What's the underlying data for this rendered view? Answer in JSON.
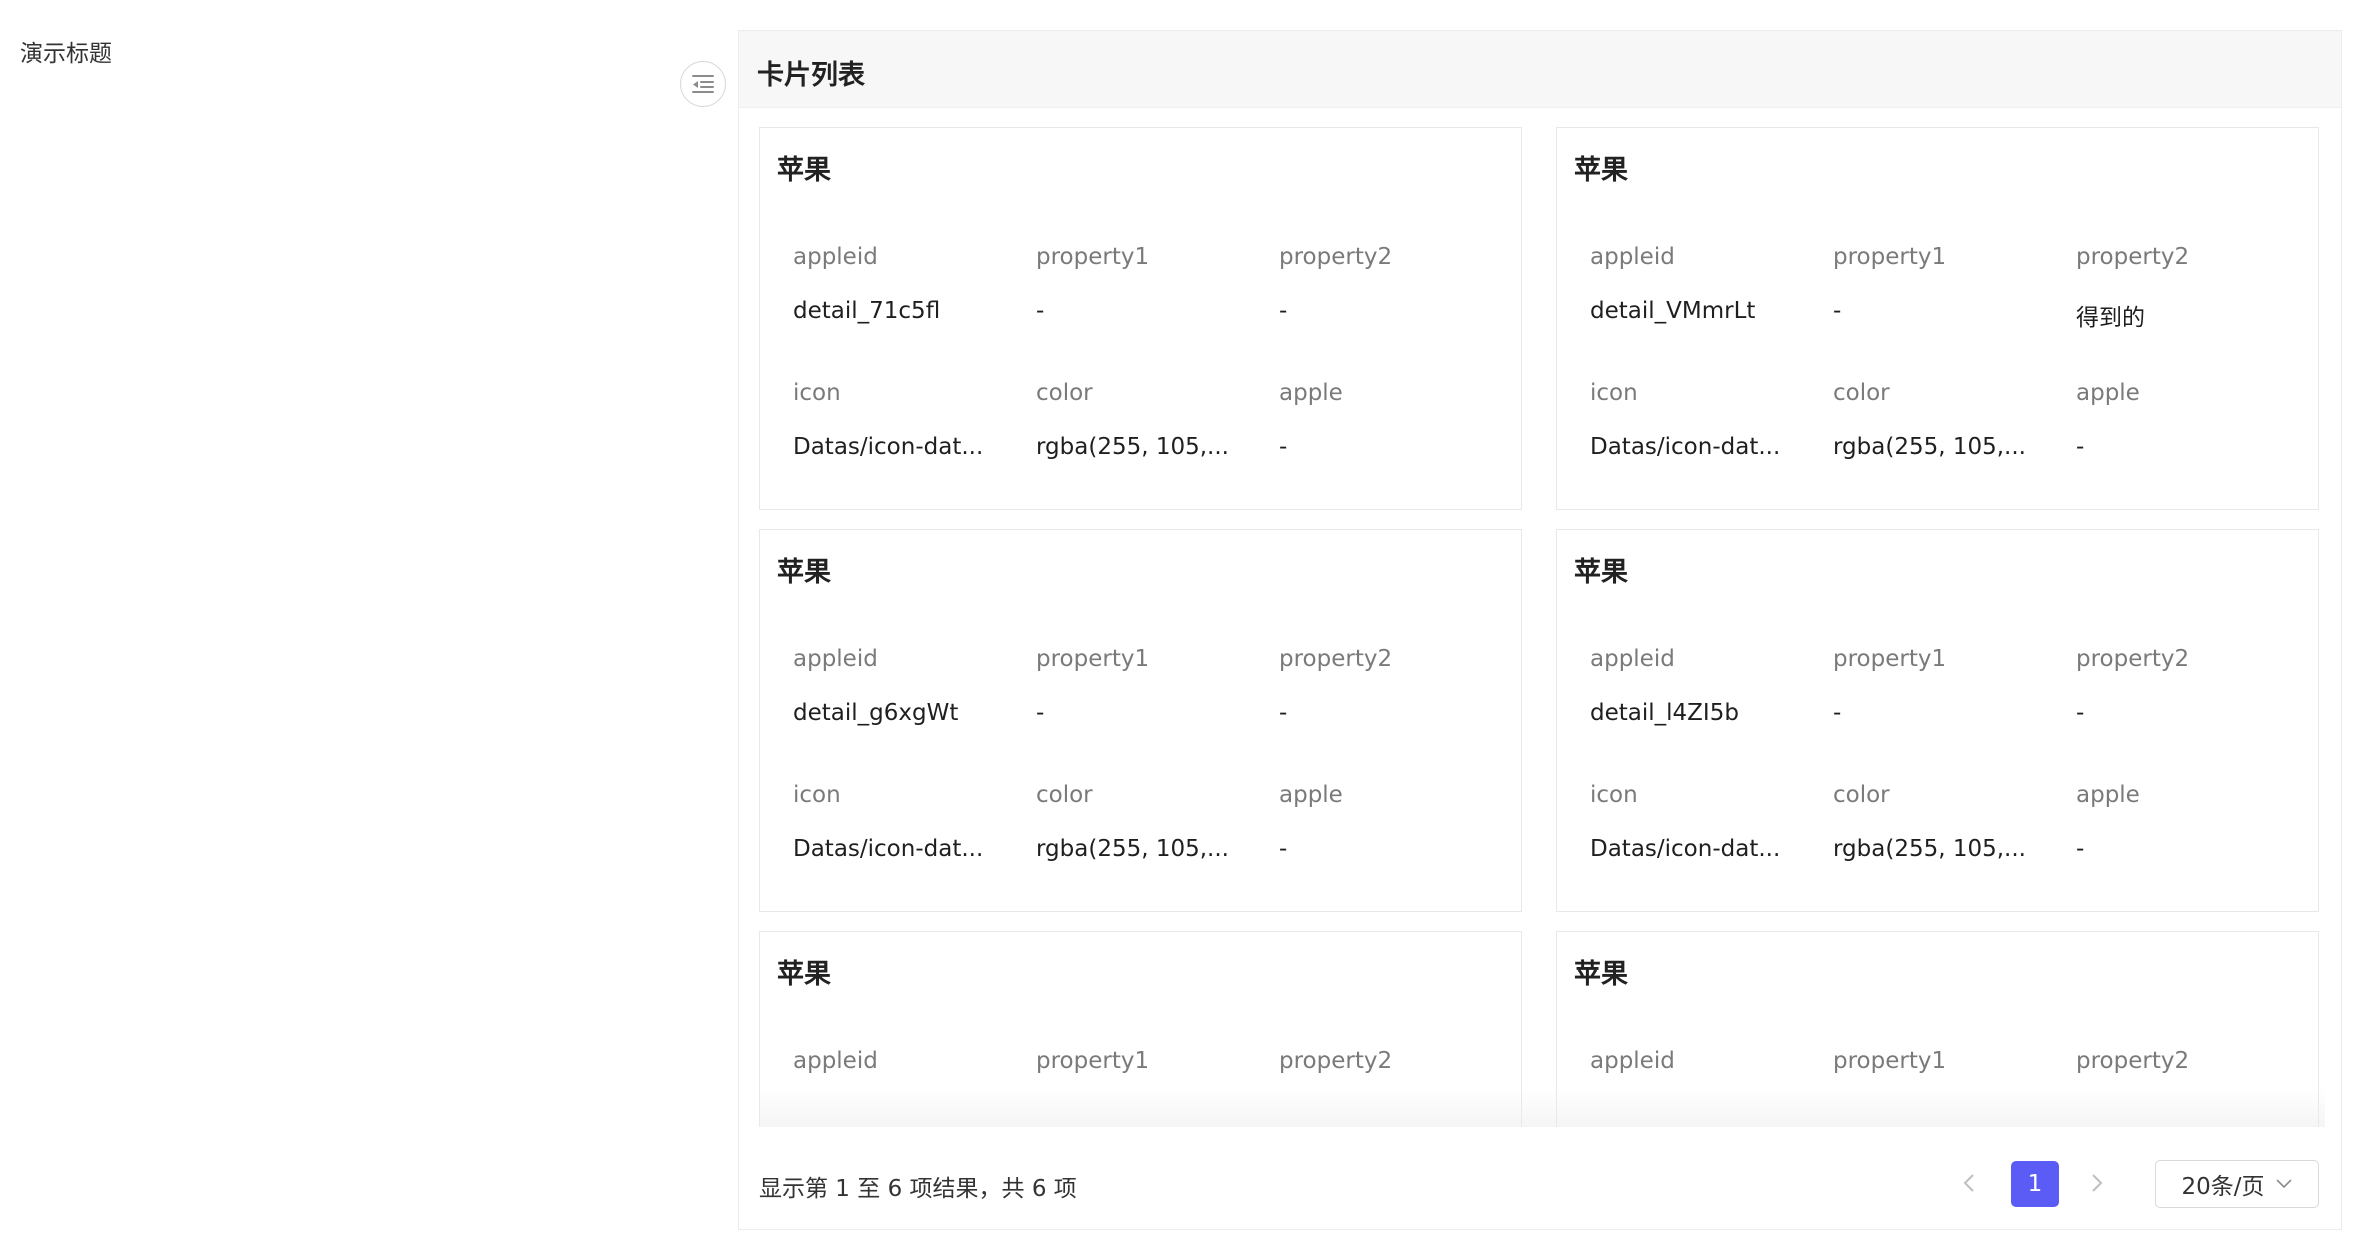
{
  "page": {
    "demo_title": "演示标题"
  },
  "panel": {
    "title": "卡片列表"
  },
  "cards": [
    {
      "title": "苹果",
      "fields": [
        {
          "label": "appleid",
          "value": "detail_71c5fl"
        },
        {
          "label": "property1",
          "value": "-"
        },
        {
          "label": "property2",
          "value": "-"
        },
        {
          "label": "icon",
          "value": "Datas/icon-dat..."
        },
        {
          "label": "color",
          "value": "rgba(255, 105,..."
        },
        {
          "label": "apple",
          "value": "-"
        }
      ]
    },
    {
      "title": "苹果",
      "fields": [
        {
          "label": "appleid",
          "value": "detail_VMmrLt"
        },
        {
          "label": "property1",
          "value": "-"
        },
        {
          "label": "property2",
          "value": "得到的"
        },
        {
          "label": "icon",
          "value": "Datas/icon-dat..."
        },
        {
          "label": "color",
          "value": "rgba(255, 105,..."
        },
        {
          "label": "apple",
          "value": "-"
        }
      ]
    },
    {
      "title": "苹果",
      "fields": [
        {
          "label": "appleid",
          "value": "detail_g6xgWt"
        },
        {
          "label": "property1",
          "value": "-"
        },
        {
          "label": "property2",
          "value": "-"
        },
        {
          "label": "icon",
          "value": "Datas/icon-dat..."
        },
        {
          "label": "color",
          "value": "rgba(255, 105,..."
        },
        {
          "label": "apple",
          "value": "-"
        }
      ]
    },
    {
      "title": "苹果",
      "fields": [
        {
          "label": "appleid",
          "value": "detail_l4ZI5b"
        },
        {
          "label": "property1",
          "value": "-"
        },
        {
          "label": "property2",
          "value": "-"
        },
        {
          "label": "icon",
          "value": "Datas/icon-dat..."
        },
        {
          "label": "color",
          "value": "rgba(255, 105,..."
        },
        {
          "label": "apple",
          "value": "-"
        }
      ]
    },
    {
      "title": "苹果",
      "fields": [
        {
          "label": "appleid",
          "value": ""
        },
        {
          "label": "property1",
          "value": ""
        },
        {
          "label": "property2",
          "value": ""
        }
      ]
    },
    {
      "title": "苹果",
      "fields": [
        {
          "label": "appleid",
          "value": ""
        },
        {
          "label": "property1",
          "value": ""
        },
        {
          "label": "property2",
          "value": ""
        }
      ]
    }
  ],
  "footer": {
    "summary": "显示第 1 至 6 项结果，共 6 项",
    "current_page": "1",
    "page_size": "20条/页"
  },
  "icons": {
    "collapse": "indent-collapse-icon",
    "prev": "chevron-left-icon",
    "next": "chevron-right-icon",
    "dropdown": "chevron-down-icon"
  },
  "colors": {
    "accent": "#5b5cf6",
    "header_bg": "#f7f7f7",
    "border": "#e8e8e8",
    "label": "#7a7a7a"
  }
}
